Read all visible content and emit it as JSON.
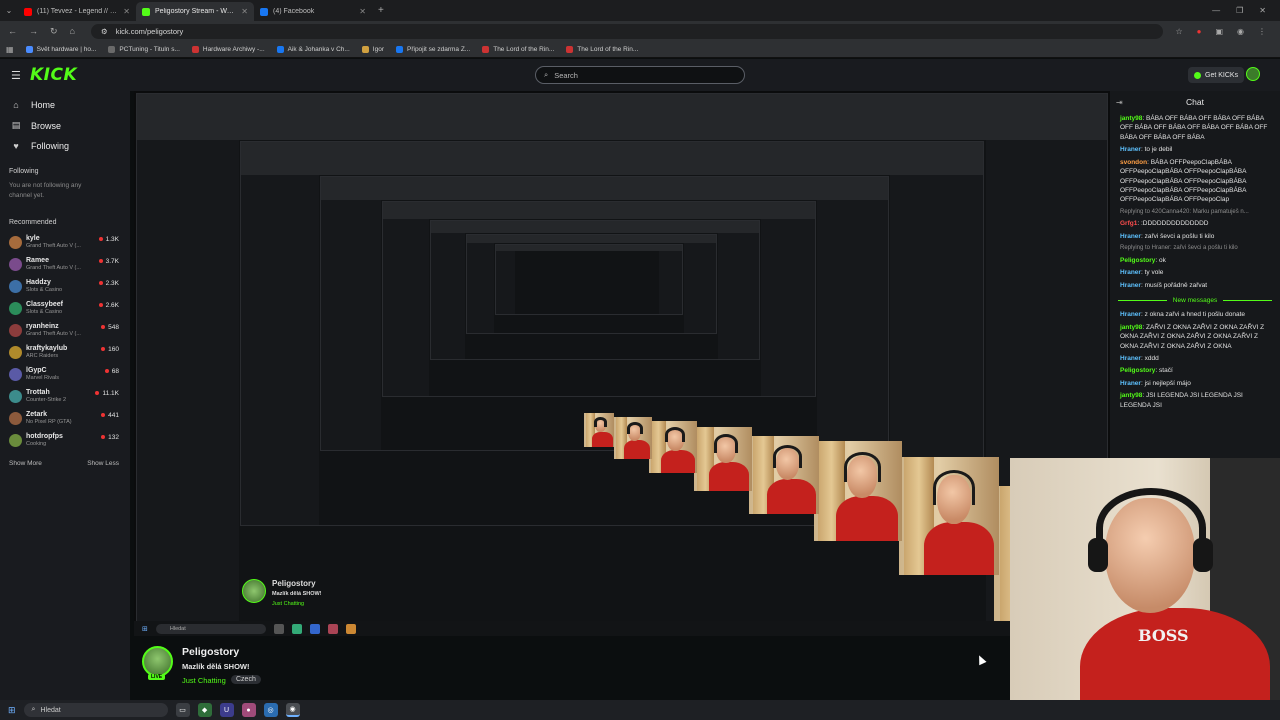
{
  "browser": {
    "tabs": [
      {
        "title": "(11) Tevvez - Legend // - YouTube",
        "color": "#ff0000",
        "active": false
      },
      {
        "title": "Peligostory Stream - Watch Live",
        "color": "#53fc18",
        "active": true
      },
      {
        "title": "(4) Facebook",
        "color": "#1877f2",
        "active": false
      }
    ],
    "url": "kick.com/peligostory",
    "bookmarks": [
      {
        "label": "Svět hardware | ho...",
        "color": "#4a8cff"
      },
      {
        "label": "PCTuning - Tituln s...",
        "color": "#6a6a6a"
      },
      {
        "label": "Hardware Archiwy -...",
        "color": "#cc3333"
      },
      {
        "label": "Aik & Johanka v Ch...",
        "color": "#1877f2"
      },
      {
        "label": "Igor",
        "color": "#d0a040"
      },
      {
        "label": "Připojit se zdarma Z...",
        "color": "#1877f2"
      },
      {
        "label": "The Lord of the Rin...",
        "color": "#cc3333"
      },
      {
        "label": "The Lord of the Rin...",
        "color": "#cc3333"
      }
    ]
  },
  "header": {
    "logo": "KICK",
    "search_placeholder": "Search",
    "get_kicks": "Get KICKs"
  },
  "sidebar": {
    "nav": [
      {
        "label": "Home",
        "icon": "home-icon"
      },
      {
        "label": "Browse",
        "icon": "browse-icon"
      },
      {
        "label": "Following",
        "icon": "heart-icon"
      }
    ],
    "following_title": "Following",
    "following_note": "You are not following any channel yet.",
    "recommended_title": "Recommended",
    "channels": [
      {
        "name": "kyle",
        "category": "Grand Theft Auto V (...",
        "viewers": "1.3K",
        "color": "#a66b3c"
      },
      {
        "name": "Ramee",
        "category": "Grand Theft Auto V (...",
        "viewers": "3.7K",
        "color": "#7a4b8c"
      },
      {
        "name": "Haddzy",
        "category": "Slots & Casino",
        "viewers": "2.3K",
        "color": "#3c6fa6"
      },
      {
        "name": "Classybeef",
        "category": "Slots & Casino",
        "viewers": "2.6K",
        "color": "#2b8c5a"
      },
      {
        "name": "ryanheinz",
        "category": "Grand Theft Auto V (...",
        "viewers": "548",
        "color": "#8c3c3c"
      },
      {
        "name": "kraftykaylub",
        "category": "ARC Raiders",
        "viewers": "160",
        "color": "#b08a2b"
      },
      {
        "name": "lGypC",
        "category": "Marvel Rivals",
        "viewers": "68",
        "color": "#5a5aa6"
      },
      {
        "name": "Trottah",
        "category": "Counter-Strike 2",
        "viewers": "11.1K",
        "color": "#3c8c8c"
      },
      {
        "name": "Zetark",
        "category": "No Pixel RP (GTA)",
        "viewers": "441",
        "color": "#8c5a3c"
      },
      {
        "name": "hotdropfps",
        "category": "Cooking",
        "viewers": "132",
        "color": "#6a8c3c"
      }
    ],
    "show_more": "Show More",
    "show_less": "Show Less"
  },
  "stream": {
    "channel": "Peligostory",
    "title": "Mazlík dělá SHOW!",
    "category": "Just Chatting",
    "tag": "Czech"
  },
  "chat": {
    "title": "Chat",
    "messages": [
      {
        "user": "janty98",
        "color": "#53fc18",
        "text": "BÁBA OFF BÁBA OFF BÁBA OFF BÁBA OFF BÁBA OFF BÁBA OFF BÁBA OFF BÁBA OFF BÁBA OFF BÁBA OFF BÁBA"
      },
      {
        "user": "Hraner",
        "color": "#5ec2ff",
        "text": "to je debil"
      },
      {
        "user": "svondon",
        "color": "#ff9f45",
        "text": "BÁBA OFFPeepoClapBÁBA OFFPeepoClapBÁBA OFFPeepoClapBÁBA OFFPeepoClapBÁBA OFFPeepoClapBÁBA OFFPeepoClapBÁBA OFFPeepoClapBÁBA OFFPeepoClapBÁBA OFFPeepoClap"
      },
      {
        "user": "",
        "color": "#8d8d8d",
        "text": "Replying to 420Canna420: Marku pamatuješ n...",
        "reply": true
      },
      {
        "user": "Grfg1",
        "color": "#ff4d4d",
        "text": ":DDDDDDDDDDDDDD"
      },
      {
        "user": "Hraner",
        "color": "#5ec2ff",
        "text": "zařvi ševci a pošlu ti kilo"
      },
      {
        "user": "",
        "color": "#8d8d8d",
        "text": "Replying to Hraner: zařvi ševci a pošlu ti kilo",
        "reply": true
      },
      {
        "user": "Peligostory",
        "color": "#53fc18",
        "text": "ok"
      },
      {
        "user": "Hraner",
        "color": "#5ec2ff",
        "text": "ty vole"
      },
      {
        "user": "Hraner",
        "color": "#5ec2ff",
        "text": "musíš pořádně zařvat"
      }
    ],
    "new_messages_label": "New messages",
    "messages_after": [
      {
        "user": "Hraner",
        "color": "#5ec2ff",
        "text": "z okna zařvi a hned ti pošlu donate"
      },
      {
        "user": "janty98",
        "color": "#53fc18",
        "text": "ZAŘVI Z OKNA ZAŘVI Z OKNA ZAŘVI Z OKNA ZAŘVI Z OKNA ZAŘVI Z OKNA ZAŘVI Z OKNA ZAŘVI Z OKNA ZAŘVI Z OKNA"
      },
      {
        "user": "Hraner",
        "color": "#5ec2ff",
        "text": "xddd"
      },
      {
        "user": "Peligostory",
        "color": "#53fc18",
        "text": "stačí"
      },
      {
        "user": "Hraner",
        "color": "#5ec2ff",
        "text": "jsi nejlepší májo"
      },
      {
        "user": "janty98",
        "color": "#53fc18",
        "text": "JSI LEGENDA JSI LEGENDA JSI LEGENDA JSI"
      }
    ]
  },
  "taskbar": {
    "search_placeholder": "Hledat"
  }
}
